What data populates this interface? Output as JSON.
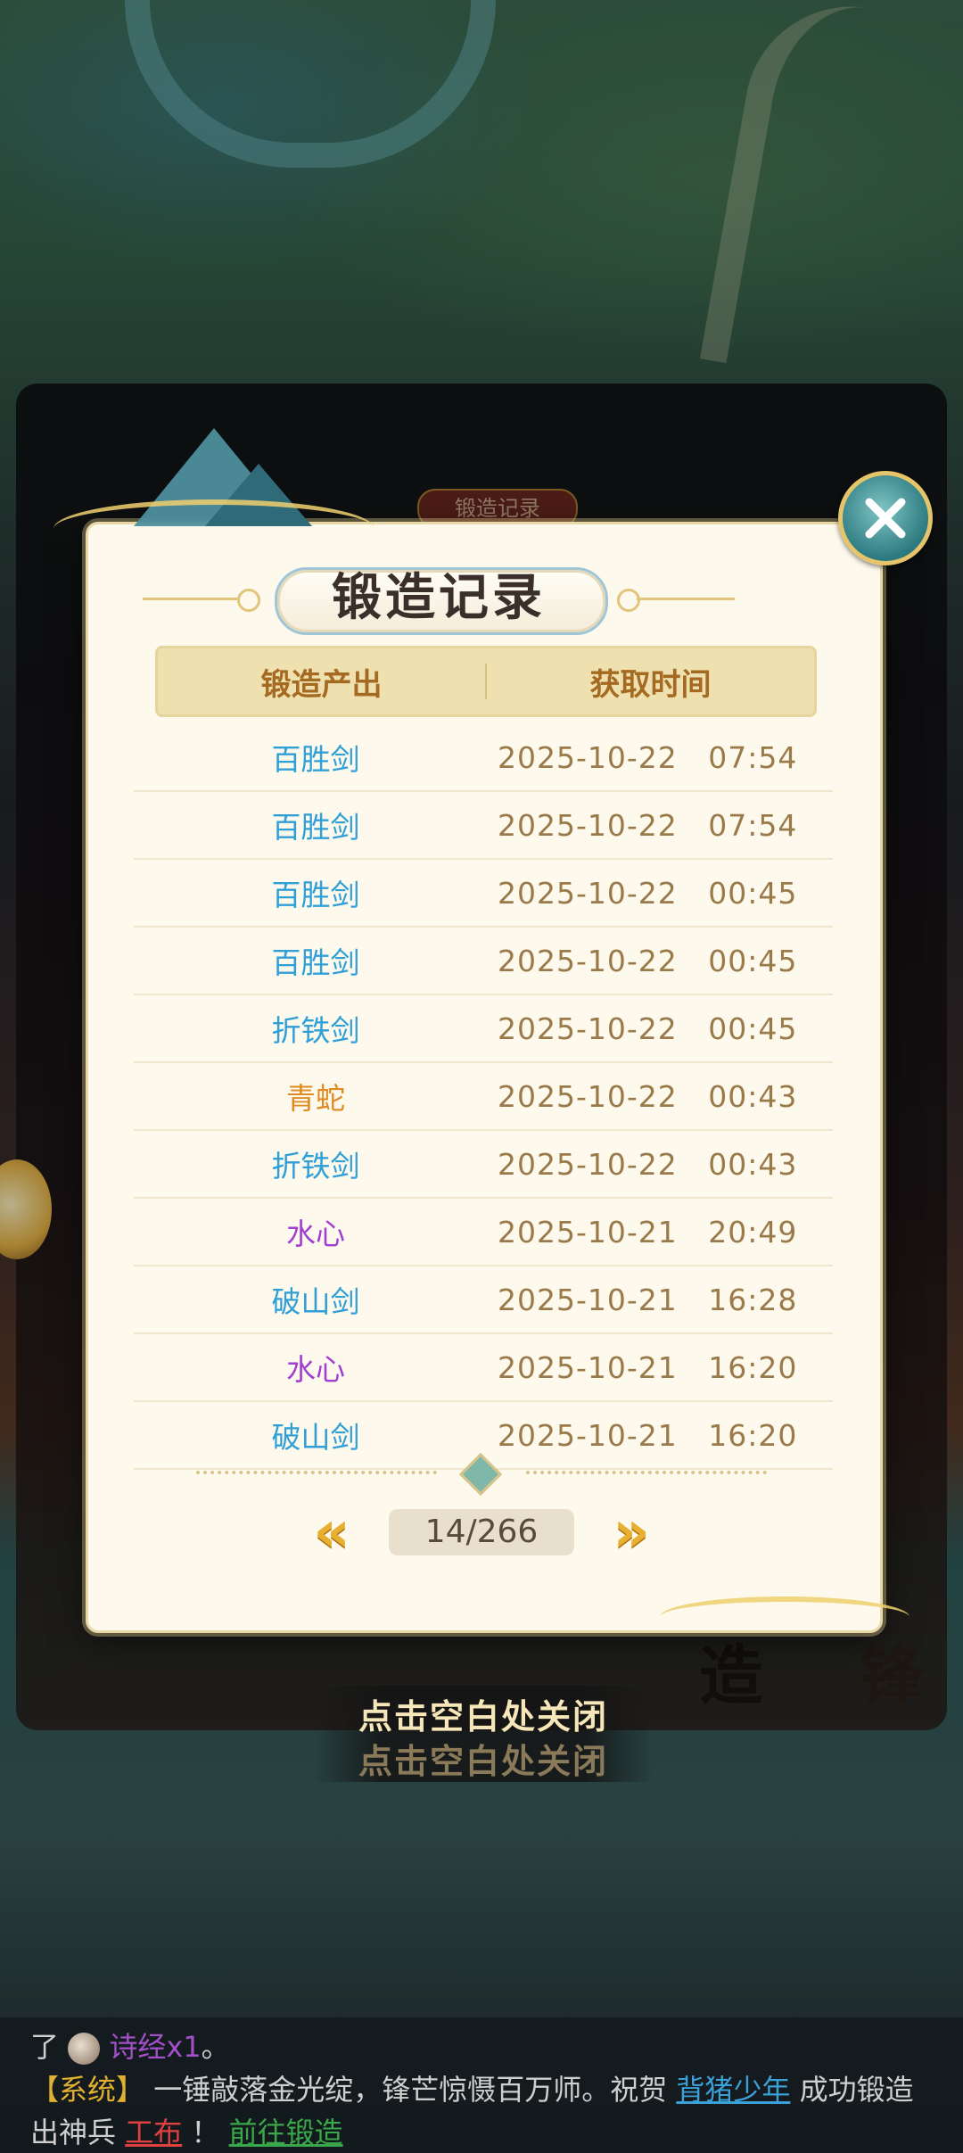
{
  "background_tab": {
    "label": "锻造记录"
  },
  "dialog": {
    "title": "锻造记录",
    "columns": {
      "output": "锻造产出",
      "time": "获取时间"
    },
    "rows": [
      {
        "item": "百胜剑",
        "time": "2025-10-22   07:54",
        "rarity_color": "#2f9fd8"
      },
      {
        "item": "百胜剑",
        "time": "2025-10-22   07:54",
        "rarity_color": "#2f9fd8"
      },
      {
        "item": "百胜剑",
        "time": "2025-10-22   00:45",
        "rarity_color": "#2f9fd8"
      },
      {
        "item": "百胜剑",
        "time": "2025-10-22   00:45",
        "rarity_color": "#2f9fd8"
      },
      {
        "item": "折铁剑",
        "time": "2025-10-22   00:45",
        "rarity_color": "#2f9fd8"
      },
      {
        "item": "青蛇",
        "time": "2025-10-22   00:43",
        "rarity_color": "#e08a22"
      },
      {
        "item": "折铁剑",
        "time": "2025-10-22   00:43",
        "rarity_color": "#2f9fd8"
      },
      {
        "item": "水心",
        "time": "2025-10-21   20:49",
        "rarity_color": "#a13fd0"
      },
      {
        "item": "破山剑",
        "time": "2025-10-21   16:28",
        "rarity_color": "#2f9fd8"
      },
      {
        "item": "水心",
        "time": "2025-10-21   16:20",
        "rarity_color": "#a13fd0"
      },
      {
        "item": "破山剑",
        "time": "2025-10-21   16:20",
        "rarity_color": "#2f9fd8"
      }
    ],
    "pager": {
      "prev": "«",
      "next": "»",
      "current": "14/266"
    },
    "close_icon": "close-x-icon"
  },
  "tap_to_close": "点击空白处关闭",
  "background_chars": {
    "left": "造",
    "right": "锋"
  },
  "chat": {
    "line1_prefix": "了",
    "line1_item": "诗经x1",
    "line1_suffix": "。",
    "channel": "【系统】",
    "message": "一锤敲落金光绽，锋芒惊慑百万师。祝贺",
    "player": "背猪少年",
    "message2": "成功锻造",
    "line3_prefix": "出神兵",
    "weapon": "工布",
    "line3_mid": "！",
    "action_link": "前往锻造"
  },
  "colors": {
    "rarity_blue": "#2f9fd8",
    "rarity_orange": "#e08a22",
    "rarity_purple": "#a13fd0",
    "header_text": "#a46a22",
    "panel_bg": "#fdf9ec"
  }
}
